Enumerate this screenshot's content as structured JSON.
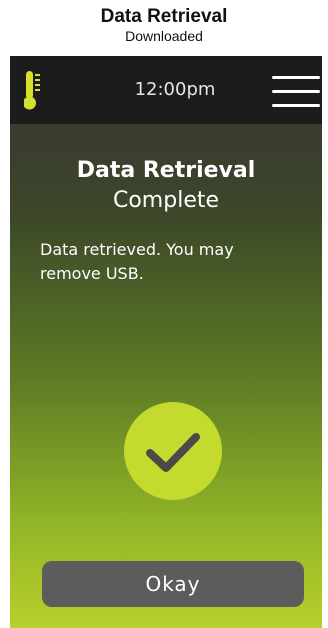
{
  "caption": {
    "title": "Data Retrieval",
    "subtitle": "Downloaded"
  },
  "status_bar": {
    "time": "12:00pm",
    "left_icon": "thermometer-icon",
    "right_icon": "hamburger-menu-icon"
  },
  "dialog": {
    "title_bold": "Data Retrieval",
    "title_normal": "Complete",
    "message": "Data retrieved. You may remove USB.",
    "status_icon": "checkmark-icon",
    "button_label": "Okay"
  },
  "colors": {
    "accent_lime": "#c4da2e",
    "topbar": "#1c1c1c",
    "button": "#5c5c5c",
    "checkmark": "#4a4a4a",
    "thermometer": "#d4e02a"
  }
}
